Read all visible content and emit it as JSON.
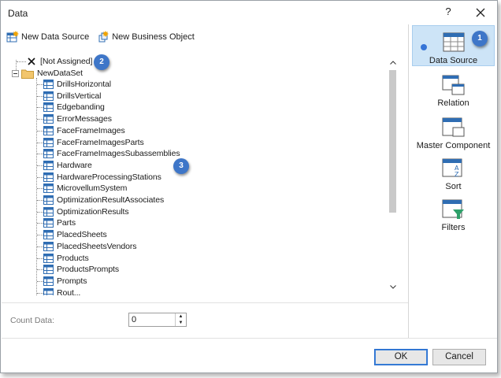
{
  "window": {
    "title": "Data",
    "help_label": "?",
    "close_label": "✕"
  },
  "toolbar": {
    "new_data_source": "New Data Source",
    "new_business_object": "New Business Object"
  },
  "tree": {
    "not_assigned": "[Not Assigned]",
    "dataset": "NewDataSet",
    "tables": [
      "DrillsHorizontal",
      "DrillsVertical",
      "Edgebanding",
      "ErrorMessages",
      "FaceFrameImages",
      "FaceFrameImagesParts",
      "FaceFrameImagesSubassemblies",
      "Hardware",
      "HardwareProcessingStations",
      "MicrovellumSystem",
      "OptimizationResultAssociates",
      "OptimizationResults",
      "Parts",
      "PlacedSheets",
      "PlacedSheetsVendors",
      "Products",
      "ProductsPrompts",
      "Prompts",
      "Rout..."
    ]
  },
  "count": {
    "label": "Count Data:",
    "value": "0"
  },
  "buttons": {
    "ok": "OK",
    "cancel": "Cancel"
  },
  "side": {
    "data_source": "Data Source",
    "relation": "Relation",
    "master_component": "Master Component",
    "sort": "Sort",
    "filters": "Filters"
  },
  "badges": {
    "one": "1",
    "two": "2",
    "three": "3"
  },
  "colors": {
    "accent": "#3e76c8",
    "selected_bg": "#cde4f7",
    "table_icon": "#2f6db3"
  }
}
